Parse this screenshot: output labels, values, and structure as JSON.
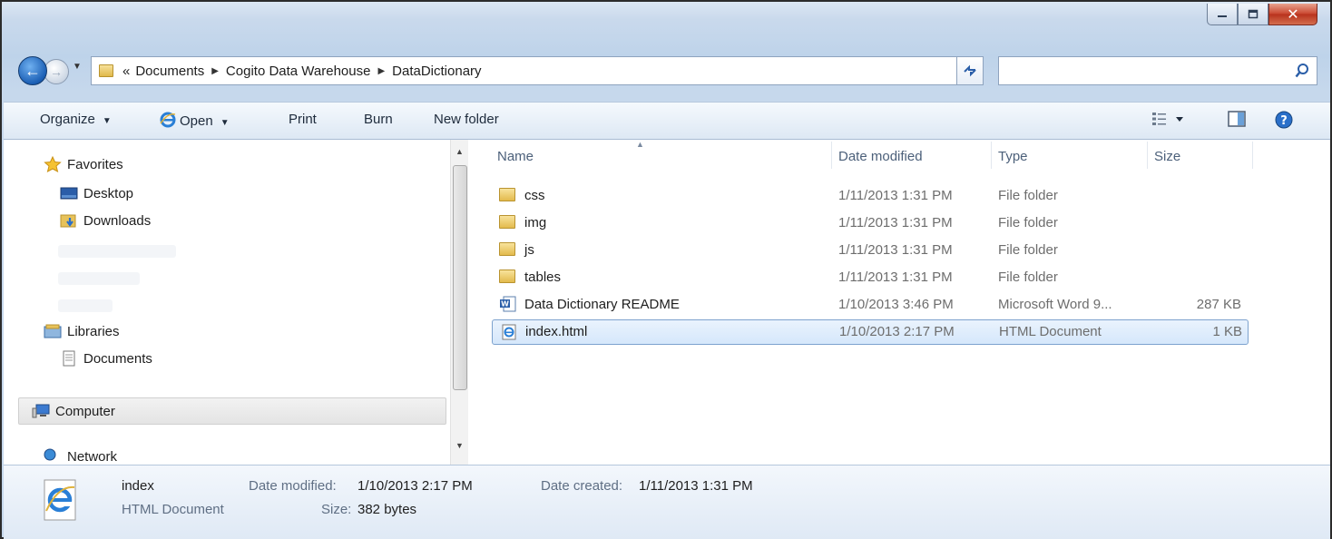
{
  "address": {
    "prefix": "«",
    "crumbs": [
      "Documents",
      "Cogito Data Warehouse",
      "DataDictionary"
    ]
  },
  "toolbar": {
    "organize": "Organize",
    "open": "Open",
    "print": "Print",
    "burn": "Burn",
    "new_folder": "New folder"
  },
  "nav": {
    "favorites": "Favorites",
    "desktop": "Desktop",
    "downloads": "Downloads",
    "libraries": "Libraries",
    "documents": "Documents",
    "computer": "Computer",
    "network": "Network"
  },
  "columns": {
    "name": "Name",
    "date": "Date modified",
    "type": "Type",
    "size": "Size"
  },
  "files": [
    {
      "name": "css",
      "date": "1/11/2013 1:31 PM",
      "type": "File folder",
      "size": "",
      "icon": "folder-icon"
    },
    {
      "name": "img",
      "date": "1/11/2013 1:31 PM",
      "type": "File folder",
      "size": "",
      "icon": "folder-icon"
    },
    {
      "name": "js",
      "date": "1/11/2013 1:31 PM",
      "type": "File folder",
      "size": "",
      "icon": "folder-icon"
    },
    {
      "name": "tables",
      "date": "1/11/2013 1:31 PM",
      "type": "File folder",
      "size": "",
      "icon": "folder-icon"
    },
    {
      "name": "Data Dictionary README",
      "date": "1/10/2013 3:46 PM",
      "type": "Microsoft Word 9...",
      "size": "287 KB",
      "icon": "word-doc-icon"
    },
    {
      "name": "index.html",
      "date": "1/10/2013 2:17 PM",
      "type": "HTML Document",
      "size": "1 KB",
      "icon": "html-doc-icon"
    }
  ],
  "selected_index": 5,
  "details": {
    "name": "index",
    "type": "HTML Document",
    "modified_label": "Date modified:",
    "modified_value": "1/10/2013 2:17 PM",
    "created_label": "Date created:",
    "created_value": "1/11/2013 1:31 PM",
    "size_label": "Size:",
    "size_value": "382 bytes"
  },
  "colors": {
    "accent": "#2a6fc9",
    "selection": "#d5e7fb",
    "close": "#c8452e"
  }
}
